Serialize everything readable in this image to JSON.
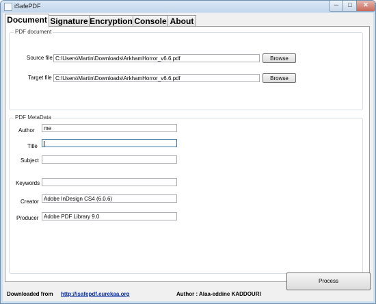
{
  "window": {
    "title": "iSafePDF",
    "controls": {
      "minimize": "─",
      "maximize": "□",
      "close": "✕"
    }
  },
  "tabs": [
    {
      "label": "Document",
      "active": true
    },
    {
      "label": "Signature",
      "active": false
    },
    {
      "label": "Encryption",
      "active": false
    },
    {
      "label": "Console",
      "active": false
    },
    {
      "label": "About",
      "active": false
    }
  ],
  "pdf_document": {
    "title": "PDF document",
    "source_label": "Source file",
    "source_value": "C:\\Users\\Martin\\Downloads\\ArkhamHorror_v6.6.pdf",
    "target_label": "Target file",
    "target_value": "C:\\Users\\Martin\\Downloads\\ArkhamHorror_v6.6.pdf",
    "browse_label": "Browse"
  },
  "metadata": {
    "title": "PDF MetaData",
    "author_label": "Author",
    "author_value": "me",
    "title_label": "Title",
    "title_value": "",
    "subject_label": "Subject",
    "subject_value": "",
    "keywords_label": "Keywords",
    "keywords_value": "",
    "creator_label": "Creator",
    "creator_value": "Adobe InDesign CS4 (6.0.6)",
    "producer_label": "Producer",
    "producer_value": "Adobe PDF Library 9.0"
  },
  "actions": {
    "process_label": "Process"
  },
  "footer": {
    "downloaded_label": "Downloaded from",
    "link_text": "http://isafepdf.eurekaa.org",
    "author_text": "Author : Alaa-eddine KADDOURI"
  }
}
